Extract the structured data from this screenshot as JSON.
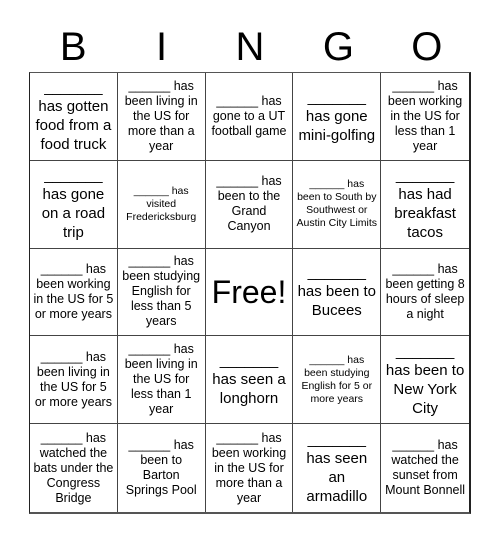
{
  "header": [
    "B",
    "I",
    "N",
    "G",
    "O"
  ],
  "cells": [
    {
      "text": "_______ has gotten food from a food truck",
      "size": "lg"
    },
    {
      "text": "______ has been living in the US for more than a year",
      "size": "md"
    },
    {
      "text": "______ has gone to a UT football game",
      "size": "md"
    },
    {
      "text": "_______ has gone mini-golfing",
      "size": "lg"
    },
    {
      "text": "______ has been working in the US for less than 1 year",
      "size": "md"
    },
    {
      "text": "_______ has gone on a road trip",
      "size": "lg"
    },
    {
      "text": "______ has visited Fredericksburg",
      "size": "sm"
    },
    {
      "text": "______ has been to the Grand Canyon",
      "size": "md"
    },
    {
      "text": "______ has been to South by Southwest or Austin City Limits",
      "size": "sm"
    },
    {
      "text": "_______ has had breakfast tacos",
      "size": "lg"
    },
    {
      "text": "______ has been working in the US for 5 or more years",
      "size": "md"
    },
    {
      "text": "______ has been studying English for less than 5 years",
      "size": "md"
    },
    {
      "text": "Free!",
      "size": "free"
    },
    {
      "text": "_______ has been to Bucees",
      "size": "lg"
    },
    {
      "text": "______ has been getting 8 hours of sleep a night",
      "size": "md"
    },
    {
      "text": "______ has been living in the US for 5 or more years",
      "size": "md"
    },
    {
      "text": "______ has been living in the US for less than 1 year",
      "size": "md"
    },
    {
      "text": "_______ has seen a longhorn",
      "size": "lg"
    },
    {
      "text": "______ has been studying English for 5 or more years",
      "size": "sm"
    },
    {
      "text": "_______ has been to New York City",
      "size": "lg"
    },
    {
      "text": "______ has watched the bats under the Congress Bridge",
      "size": "md"
    },
    {
      "text": "______ has been to Barton Springs Pool",
      "size": "md"
    },
    {
      "text": "______ has been working in the US for more than a year",
      "size": "md"
    },
    {
      "text": "_______ has seen an armadillo",
      "size": "lg"
    },
    {
      "text": "______ has watched the sunset from Mount Bonnell",
      "size": "md"
    }
  ]
}
